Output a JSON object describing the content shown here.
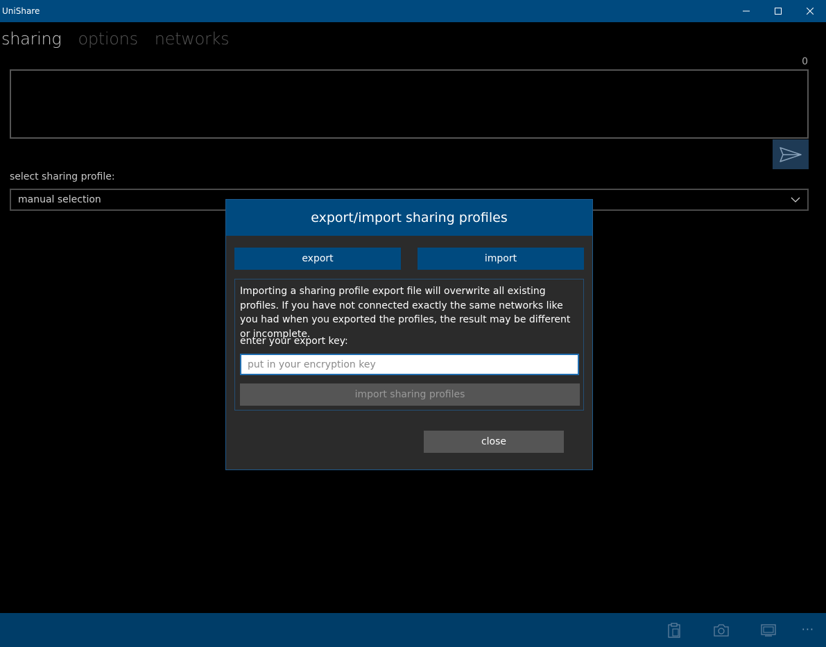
{
  "window": {
    "title": "UniShare"
  },
  "pivot": {
    "tabs": [
      {
        "label": "sharing",
        "active": true
      },
      {
        "label": "options",
        "active": false
      },
      {
        "label": "networks",
        "active": false
      }
    ]
  },
  "sharing": {
    "char_count": "0",
    "message_value": "",
    "profile_label": "select sharing profile:",
    "profile_selected": "manual selection"
  },
  "dialog": {
    "title": "export/import sharing profiles",
    "export_label": "export",
    "import_label": "import",
    "import_text": "Importing a sharing profile export file will overwrite all existing profiles. If you have not connected exactly the same networks like you had when you exported the profiles, the result may be different or incomplete.",
    "key_label": "enter your export key:",
    "key_placeholder": "put in your encryption key",
    "key_value": "",
    "import_profiles_label": "import sharing profiles",
    "close_label": "close"
  },
  "appbar": {
    "more_label": "···"
  },
  "colors": {
    "accent": "#004a7f",
    "appbar": "#003d68",
    "dialog_bg": "#2b2b2b",
    "disabled_button": "#555555"
  },
  "icons": [
    "minimize-icon",
    "maximize-icon",
    "close-icon",
    "send-icon",
    "chevron-down-icon",
    "clipboard-icon",
    "camera-icon",
    "screen-icon"
  ]
}
